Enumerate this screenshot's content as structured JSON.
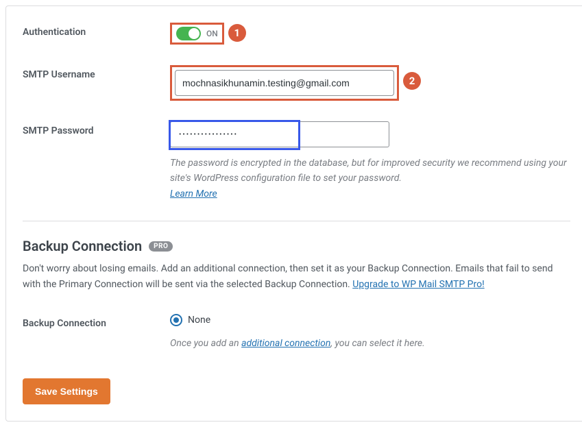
{
  "labels": {
    "authentication": "Authentication",
    "smtp_username": "SMTP Username",
    "smtp_password": "SMTP Password",
    "backup_connection": "Backup Connection"
  },
  "authentication": {
    "toggle_state": "ON"
  },
  "smtp_username": {
    "value": "mochnasikhunamin.testing@gmail.com"
  },
  "smtp_password": {
    "value": "••••••••••••••••",
    "helper_text_1": "The password is encrypted in the database, but for improved security we recommend using your site's WordPress configuration file to set your password.",
    "learn_more": "Learn More"
  },
  "backup_section": {
    "heading": "Backup Connection",
    "pro_badge": "PRO",
    "description_1": "Don't worry about losing emails. Add an additional connection, then set it as your Backup Connection. Emails that fail to send with the Primary Connection will be sent via the selected Backup Connection. ",
    "upgrade_link": "Upgrade to WP Mail SMTP Pro!",
    "radio_none": "None",
    "helper_pre": "Once you add an ",
    "helper_link": "additional connection",
    "helper_post": ", you can select it here."
  },
  "buttons": {
    "save": "Save Settings"
  },
  "annotations": {
    "step1": "1",
    "step2": "2"
  }
}
